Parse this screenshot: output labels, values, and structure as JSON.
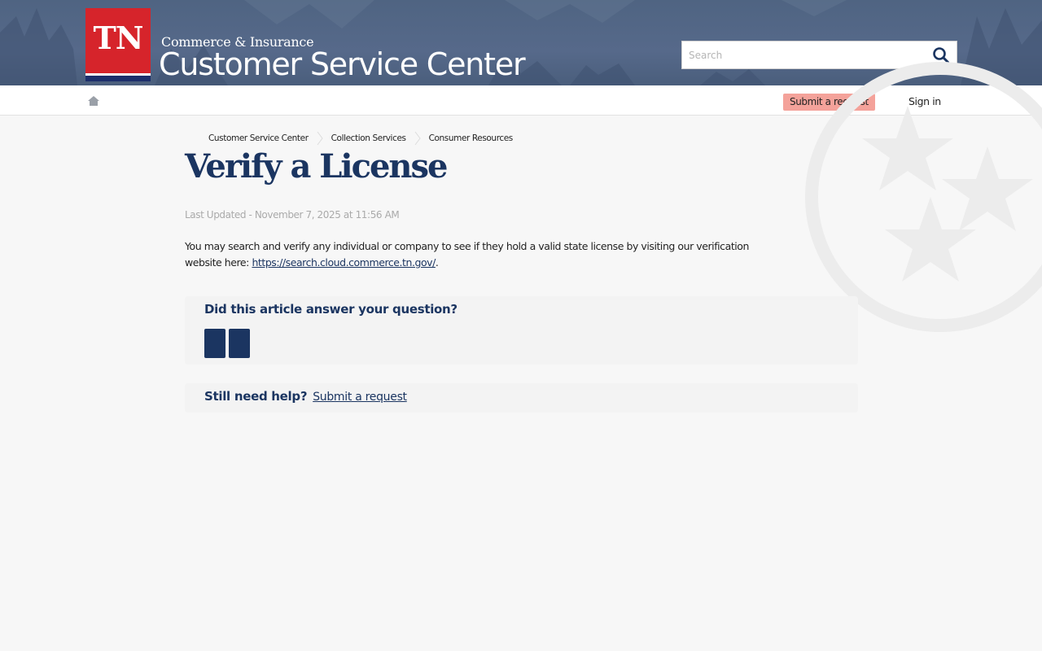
{
  "header": {
    "logo_text": "TN",
    "subtitle": "Commerce & Insurance",
    "title": "Customer Service Center",
    "search_placeholder": "Search"
  },
  "nav": {
    "submit_request": "Submit a request",
    "sign_in": "Sign in"
  },
  "breadcrumb": [
    "Customer Service Center",
    "Collection Services",
    "Consumer Resources"
  ],
  "article": {
    "title": "Verify a License",
    "last_updated": "Last Updated - November 7, 2025 at 11:56 AM",
    "body_prefix": "You may search and verify any individual or company to see if they hold a valid state license by visiting our verification website here: ",
    "body_link": "https://search.cloud.commerce.tn.gov/",
    "body_suffix": "."
  },
  "feedback": {
    "question": "Did this article answer your question?",
    "yes_icon": "",
    "no_icon": ""
  },
  "help": {
    "label": "Still need help?",
    "link": "Submit a request"
  },
  "colors": {
    "brand_navy": "#1b3561",
    "logo_red": "#d6242b",
    "header_blue": "#4f6482",
    "submit_button": "#f4a29a"
  },
  "icons": {
    "search": "search-icon",
    "home": "home-icon",
    "vote_up": "thumbs-up-icon",
    "vote_down": "thumbs-down-icon"
  }
}
